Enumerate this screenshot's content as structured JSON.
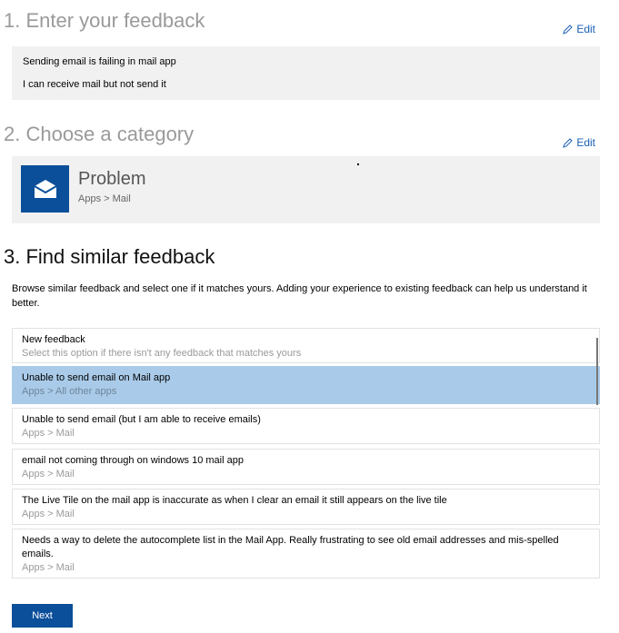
{
  "step1": {
    "heading": "1. Enter your feedback",
    "edit_label": "Edit",
    "lines": [
      "Sending email is failing in mail app",
      "I can receive mail but not send it"
    ]
  },
  "step2": {
    "heading": "2. Choose a category",
    "edit_label": "Edit",
    "category": {
      "title": "Problem",
      "path": "Apps > Mail",
      "icon": "mail-icon"
    }
  },
  "step3": {
    "heading": "3. Find similar feedback",
    "description": "Browse similar feedback and select one if it matches yours. Adding your experience to existing feedback can help us understand it better.",
    "items": [
      {
        "title": "New feedback",
        "subtitle": "Select this option if there isn't any feedback that matches yours"
      },
      {
        "title": "Unable to send email on Mail app",
        "subtitle": "Apps > All other apps",
        "selected": true
      },
      {
        "title": "Unable to send email (but I am able to receive emails)",
        "subtitle": "Apps > Mail"
      },
      {
        "title": "email not coming through on windows 10 mail app",
        "subtitle": "Apps > Mail"
      },
      {
        "title": "The Live Tile on the mail app is inaccurate as when I clear an email it still appears on the live tile",
        "subtitle": "Apps > Mail"
      },
      {
        "title": "Needs a way to delete the autocomplete list in the Mail App.  Really frustrating to see old email addresses and mis-spelled emails.",
        "subtitle": "Apps > Mail"
      }
    ]
  },
  "next_label": "Next",
  "colors": {
    "accent": "#0b4f9a",
    "selected": "#a9cbe9",
    "panel": "#f1f1f1"
  }
}
